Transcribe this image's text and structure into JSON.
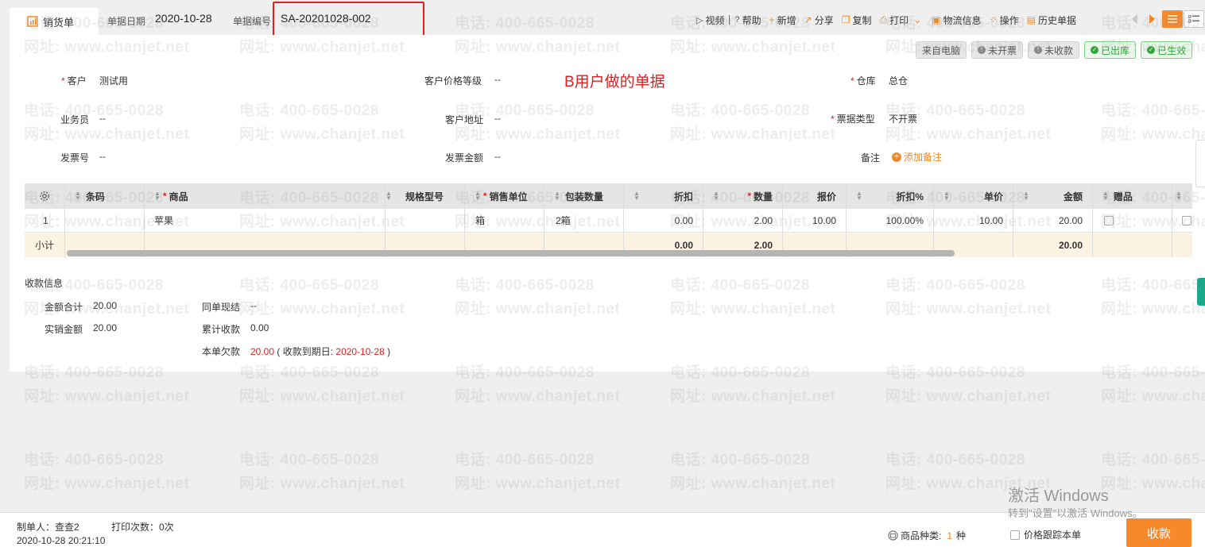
{
  "header": {
    "tab_label": "销货单",
    "date_label": "单据日期",
    "date_value": "2020-10-28",
    "number_label": "单据编号",
    "number_value": "SA-20201028-002"
  },
  "toolbar": {
    "video": "视频",
    "help": "帮助",
    "new": "新增",
    "share": "分享",
    "copy": "复制",
    "print": "打印",
    "logistics": "物流信息",
    "operate": "操作",
    "history": "历史单据"
  },
  "tags": {
    "source": "来自电脑",
    "invoice": "未开票",
    "payment": "未收款",
    "stock_out": "已出库",
    "effective": "已生效"
  },
  "form": {
    "customer_label": "客户",
    "customer_value": "测试用",
    "price_level_label": "客户价格等级",
    "price_level_value": "--",
    "warehouse_label": "仓库",
    "warehouse_value": "总仓",
    "salesman_label": "业务员",
    "salesman_value": "--",
    "address_label": "客户地址",
    "address_value": "--",
    "bill_type_label": "票据类型",
    "bill_type_value": "不开票",
    "invoice_no_label": "发票号",
    "invoice_no_value": "--",
    "invoice_amount_label": "发票金额",
    "invoice_amount_value": "--",
    "remark_label": "备注",
    "add_remark": "添加备注"
  },
  "annotation": "B用户做的单据",
  "table": {
    "headers": {
      "barcode": "条码",
      "product": "商品",
      "spec": "规格型号",
      "unit": "销售单位",
      "pack_qty": "包装数量",
      "discount": "折扣",
      "qty": "数量",
      "quote": "报价",
      "discount_pct": "折扣%",
      "unit_price": "单价",
      "amount": "金额",
      "gift": "赠品"
    },
    "row": {
      "index": "1",
      "product": "苹果",
      "unit": "箱",
      "pack_qty": "2箱",
      "discount": "0.00",
      "qty": "2.00",
      "quote": "10.00",
      "discount_pct": "100.00%",
      "unit_price": "10.00",
      "amount": "20.00"
    },
    "subtotal": {
      "label": "小计",
      "discount": "0.00",
      "qty": "2.00",
      "amount": "20.00"
    }
  },
  "payment": {
    "title": "收款信息",
    "total_label": "金额合计",
    "total_value": "20.00",
    "actual_label": "实销金额",
    "actual_value": "20.00",
    "same_cash_label": "同单现结",
    "same_cash_value": "--",
    "accum_label": "累计收款",
    "accum_value": "0.00",
    "owed_label": "本单欠款",
    "owed_value": "20.00",
    "due_prefix": "( 收款到期日:",
    "due_date": "2020-10-28",
    "due_suffix": ")"
  },
  "footer": {
    "creator": "制单人：查查2",
    "print_count": "打印次数：0次",
    "created_time": "2020-10-28 20:21:10",
    "product_kinds_label": "商品种类:",
    "product_kinds_value": "1",
    "product_kinds_unit": "种",
    "price_track": "价格跟踪本单",
    "collect_button": "收款"
  },
  "watermark": {
    "phone": "电话: 400-665-0028",
    "site": "网址: www.chanjet.net"
  },
  "windows_activation": {
    "line1": "激活 Windows",
    "line2": "转到\"设置\"以激活 Windows。"
  },
  "colors": {
    "accent_orange": "#f7892c",
    "required_red": "#e02020",
    "status_green": "#2fa63a"
  }
}
